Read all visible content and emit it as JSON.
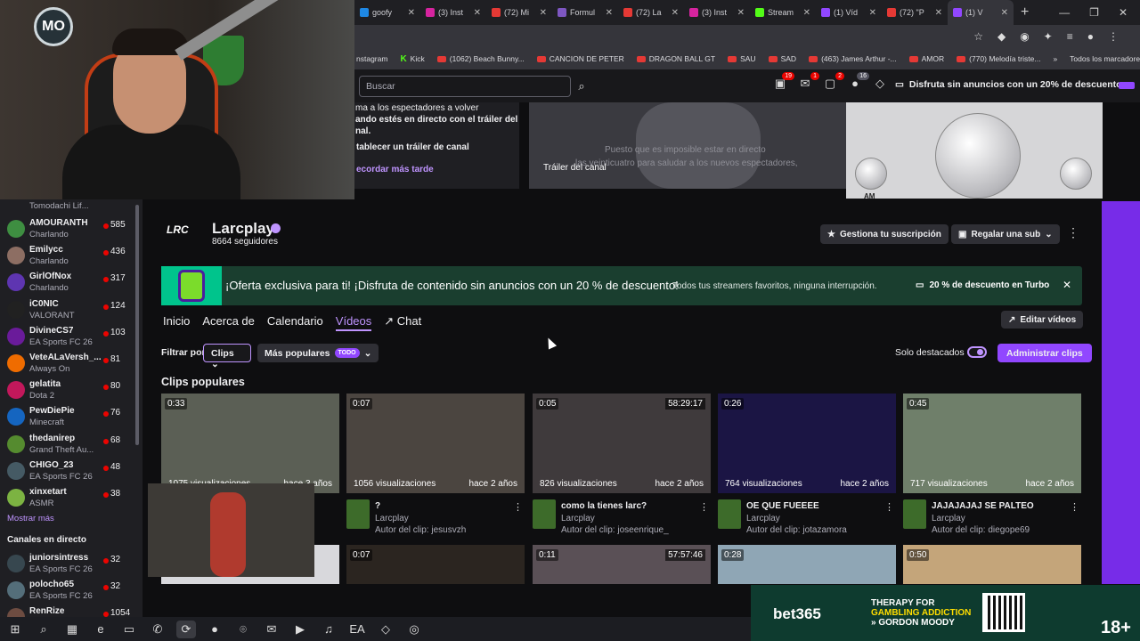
{
  "browser": {
    "tabs": [
      {
        "label": "goofy",
        "color": "#1e88e5"
      },
      {
        "label": "(3) Inst",
        "color": "#d6249f"
      },
      {
        "label": "(72) Mi",
        "color": "#e53935"
      },
      {
        "label": "Formul",
        "color": "#7e57c2"
      },
      {
        "label": "(72) La",
        "color": "#e53935"
      },
      {
        "label": "(3) Inst",
        "color": "#d6249f"
      },
      {
        "label": "Stream",
        "color": "#53fc18"
      },
      {
        "label": "(1) Víd",
        "color": "#9147ff"
      },
      {
        "label": "(72) \"P",
        "color": "#e53935"
      },
      {
        "label": "(1) V",
        "color": "#9147ff"
      }
    ],
    "new_tab": "+",
    "window_controls": [
      "—",
      "❐",
      "✕"
    ],
    "bookmarks": [
      {
        "label": "nstagram",
        "type": "plain"
      },
      {
        "label": "Kick",
        "type": "kick"
      },
      {
        "label": "(1062) Beach Bunny...",
        "type": "yt"
      },
      {
        "label": "CANCION DE PETER",
        "type": "yt"
      },
      {
        "label": "DRAGON BALL GT",
        "type": "yt"
      },
      {
        "label": "SAU",
        "type": "yt"
      },
      {
        "label": "SAD",
        "type": "yt"
      },
      {
        "label": "(463) James Arthur -...",
        "type": "yt"
      },
      {
        "label": "AMOR",
        "type": "yt"
      },
      {
        "label": "(770) Melodía triste...",
        "type": "yt"
      }
    ],
    "bookmarks_more": "»",
    "bookmarks_all": "Todos los marcadores"
  },
  "twitch_top": {
    "search_placeholder": "Buscar",
    "badges": [
      "19",
      "1",
      "2",
      "16"
    ],
    "turbo_text": "Disfruta sin anuncios con un 20% de descuento."
  },
  "trailer": {
    "line1": "ma a los espectadores a volver",
    "line2": "ando estés en directo con el tráiler del",
    "line3": "nal.",
    "setup": "tablecer un tráiler de canal",
    "later": "ecordar más tarde",
    "caption1": "Puesto que es imposible estar en directo",
    "caption2": "las veinticuatro para saludar a los nuevos espectadores,",
    "label": "Tráiler del canal",
    "radio_labels": [
      "AM",
      "FM"
    ]
  },
  "webcam": {
    "logo": "MO"
  },
  "sidebar": {
    "top_partial": "Tomodachi Lif...",
    "channels": [
      {
        "name": "AMOURANTH",
        "game": "Charlando",
        "viewers": "585",
        "color": "#3e8e41"
      },
      {
        "name": "Emilycc",
        "game": "Charlando",
        "viewers": "436",
        "color": "#8d6e63"
      },
      {
        "name": "GirlOfNox",
        "game": "Charlando",
        "viewers": "317",
        "color": "#5e35b1"
      },
      {
        "name": "iC0NIC",
        "game": "VALORANT",
        "viewers": "124",
        "color": "#212121"
      },
      {
        "name": "DivineCS7",
        "game": "EA Sports FC 26",
        "viewers": "103",
        "color": "#6a1b9a"
      },
      {
        "name": "VeteALaVersh_...",
        "game": "Always On",
        "viewers": "81",
        "color": "#ef6c00"
      },
      {
        "name": "gelatita",
        "game": "Dota 2",
        "viewers": "80",
        "color": "#c2185b"
      },
      {
        "name": "PewDiePie",
        "game": "Minecraft",
        "viewers": "76",
        "color": "#1565c0"
      },
      {
        "name": "thedanirep",
        "game": "Grand Theft Au...",
        "viewers": "68",
        "color": "#558b2f"
      },
      {
        "name": "CHIGO_23",
        "game": "EA Sports FC 26",
        "viewers": "48",
        "color": "#455a64"
      },
      {
        "name": "xinxetart",
        "game": "ASMR",
        "viewers": "38",
        "color": "#7cb342"
      }
    ],
    "show_more": "Mostrar más",
    "live_heading": "Canales en directo",
    "live": [
      {
        "name": "juniorsintress",
        "game": "EA Sports FC 26",
        "viewers": "32",
        "color": "#37474f"
      },
      {
        "name": "polocho65",
        "game": "EA Sports FC 26",
        "viewers": "32",
        "color": "#546e7a"
      },
      {
        "name": "RenRize",
        "game": "",
        "viewers": "1054",
        "color": "#6d4c41"
      }
    ]
  },
  "channel": {
    "logo": "LRC",
    "name": "Larcplay",
    "followers": "8664 seguidores",
    "subscription_button": "Gestiona tu suscripción",
    "gift_button": "Regalar una sub",
    "more": "⋮"
  },
  "promo": {
    "title": "¡Oferta exclusiva para ti! ¡Disfruta de contenido sin anuncios con un 20 % de descuento!",
    "subtitle": "Todos tus streamers favoritos, ninguna interrupción.",
    "turbo": "20 % de descuento en Turbo",
    "close": "✕"
  },
  "nav": {
    "tabs": [
      "Inicio",
      "Acerca de",
      "Calendario",
      "Vídeos",
      "Chat"
    ],
    "edit_videos": "Editar vídeos"
  },
  "filters": {
    "label": "Filtrar por",
    "clips": "Clips",
    "popular": "Más populares",
    "todo": "TODO",
    "solo": "Solo destacados",
    "admin": "Administrar clips"
  },
  "clips_heading": "Clips populares",
  "clips": [
    {
      "duration": "0:33",
      "views": "1075 visualizaciones",
      "age": "hace 3 años",
      "title": "",
      "channel": "",
      "author": "",
      "bg": "#5b5f55"
    },
    {
      "duration": "0:07",
      "views": "1056 visualizaciones",
      "age": "hace 2 años",
      "title": "?",
      "channel": "Larcplay",
      "author": "Autor del clip: jesusvzh",
      "bg": "#4b4540"
    },
    {
      "duration": "0:05",
      "views": "826 visualizaciones",
      "age": "hace 2 años",
      "title": "como la tienes larc?",
      "channel": "Larcplay",
      "author": "Autor del clip: joseenrique_",
      "bg": "#3f3a3c",
      "vod": "58:29:17"
    },
    {
      "duration": "0:26",
      "views": "764 visualizaciones",
      "age": "hace 2 años",
      "title": "OE QUE FUEEEE",
      "channel": "Larcplay",
      "author": "Autor del clip: jotazamora",
      "bg": "#1b1544"
    },
    {
      "duration": "0:45",
      "views": "717 visualizaciones",
      "age": "hace 2 años",
      "title": "JAJAJAJAJ SE PALTEO",
      "channel": "Larcplay",
      "author": "Autor del clip: diegope69",
      "bg": "#6f7f6a"
    }
  ],
  "clips_row2": [
    {
      "duration": "",
      "bg": "#d8d8dc"
    },
    {
      "duration": "0:07",
      "bg": "#2b2520"
    },
    {
      "duration": "0:11",
      "bg": "#5a5056",
      "vod": "57:57:46"
    },
    {
      "duration": "0:28",
      "bg": "#8fa6b5"
    },
    {
      "duration": "0:50",
      "bg": "#c4a57a"
    }
  ],
  "ad": {
    "logo": "bet365",
    "line1": "THERAPY FOR",
    "line2": "GAMBLING ADDICTION",
    "line3": "» GORDON MOODY",
    "age": "18+"
  },
  "taskbar": [
    "⊞",
    "⌕",
    "▦",
    "e",
    "▭",
    "✆",
    "⟳",
    "●",
    "⌾",
    "✉",
    "▶",
    "♫",
    "EA",
    "◇",
    "◎"
  ]
}
